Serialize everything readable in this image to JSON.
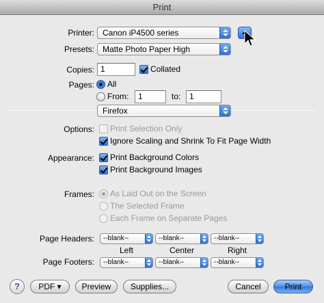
{
  "window": {
    "title": "Print"
  },
  "printer": {
    "label": "Printer:",
    "value": "Canon iP4500 series"
  },
  "presets": {
    "label": "Presets:",
    "value": "Matte Photo Paper High"
  },
  "copies": {
    "label": "Copies:",
    "value": "1",
    "collated_label": "Collated"
  },
  "pages": {
    "label": "Pages:",
    "all_label": "All",
    "from_label": "From:",
    "from_value": "1",
    "to_label": "to:",
    "to_value": "1"
  },
  "section": {
    "value": "Firefox"
  },
  "options": {
    "label": "Options:",
    "print_selection_only": "Print Selection Only",
    "ignore_scaling": "Ignore Scaling and Shrink To Fit Page Width"
  },
  "appearance": {
    "label": "Appearance:",
    "bg_colors": "Print Background Colors",
    "bg_images": "Print Background Images"
  },
  "frames": {
    "label": "Frames:",
    "as_laid_out": "As Laid Out on the Screen",
    "selected_frame": "The Selected Frame",
    "each_frame": "Each Frame on Separate Pages"
  },
  "headers": {
    "label": "Page Headers:",
    "left": "--blank--",
    "center": "--blank--",
    "right": "--blank--"
  },
  "columns": {
    "left": "Left",
    "center": "Center",
    "right": "Right"
  },
  "footers": {
    "label": "Page Footers:",
    "left": "--blank--",
    "center": "--blank--",
    "right": "--blank--"
  },
  "buttons": {
    "help": "?",
    "pdf": "PDF ▾",
    "preview": "Preview",
    "supplies": "Supplies...",
    "cancel": "Cancel",
    "print": "Print"
  },
  "colors": {
    "accent": "#2f6fd6",
    "window_bg": "#e9e9e9"
  }
}
